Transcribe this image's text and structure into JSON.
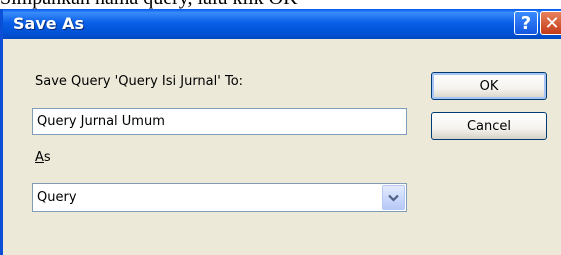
{
  "caption": "Simpankan nama query, lalu klik OK",
  "dialog": {
    "title": "Save As",
    "help_glyph": "?",
    "close_glyph": "✕",
    "save_label": "Save Query 'Query Isi Jurnal' To:",
    "name_value": "Query Jurnal Umum",
    "as_label_underlined": "A",
    "as_label_rest": "s",
    "type_value": "Query",
    "ok_label": "OK",
    "cancel_label": "Cancel"
  },
  "colors": {
    "titlebar": "#0a5fe8",
    "window_bg": "#ece9d8",
    "close_button": "#c43a17"
  }
}
